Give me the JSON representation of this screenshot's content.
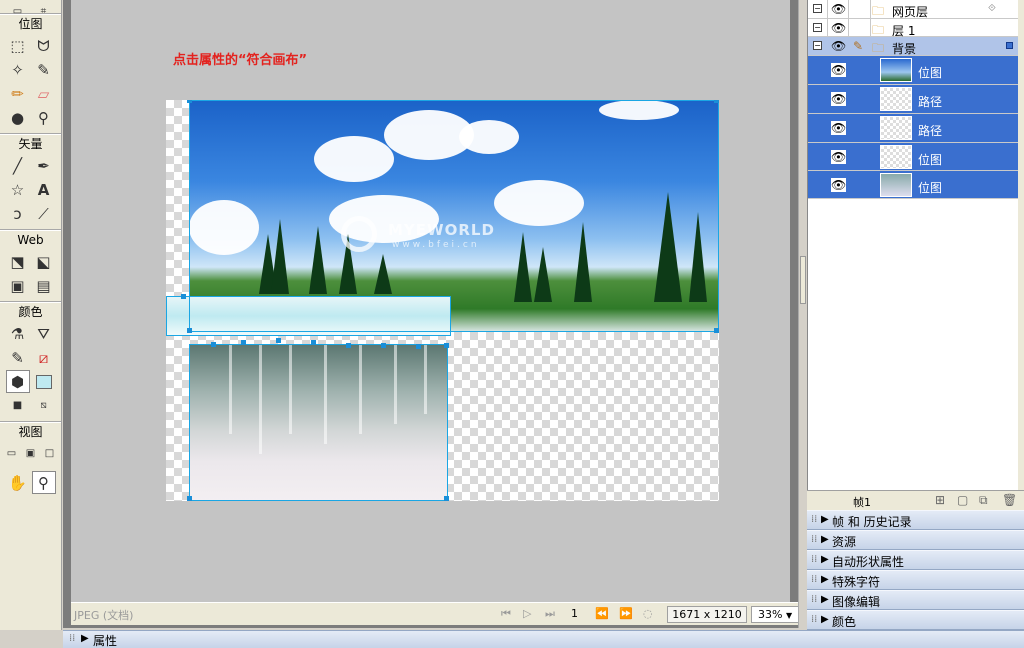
{
  "toolbar": {
    "sections": [
      {
        "header": "位图"
      },
      {
        "header": "矢量"
      },
      {
        "header": "Web"
      },
      {
        "header": "颜色"
      },
      {
        "header": "视图"
      }
    ]
  },
  "canvas": {
    "instruction": "点击属性的“符合画布”",
    "watermark": "MYEWORLD",
    "watermark_sub": "www.bfei.cn"
  },
  "doc_status": {
    "file_label": "JPEG (文档)",
    "frame_number": "1",
    "dimensions": "1671 x 1210",
    "zoom": "33%"
  },
  "layers": {
    "rows": [
      {
        "name": "网页层",
        "type": "layer"
      },
      {
        "name": "层 1",
        "type": "layer"
      },
      {
        "name": "背景",
        "type": "layer-active"
      },
      {
        "name": "位图",
        "type": "object"
      },
      {
        "name": "路径",
        "type": "object"
      },
      {
        "name": "路径",
        "type": "object"
      },
      {
        "name": "位图",
        "type": "object"
      },
      {
        "name": "位图",
        "type": "object"
      }
    ]
  },
  "frames": {
    "label": "帧1"
  },
  "panels": [
    {
      "title": "帧 和 历史记录"
    },
    {
      "title": "资源"
    },
    {
      "title": "自动形状属性"
    },
    {
      "title": "特殊字符"
    },
    {
      "title": "图像编辑"
    },
    {
      "title": "颜色"
    }
  ],
  "properties": {
    "title": "属性"
  },
  "colors": {
    "selection": "#3a6fcf",
    "instruction": "#e3221e",
    "handle": "#1a8fd8"
  }
}
